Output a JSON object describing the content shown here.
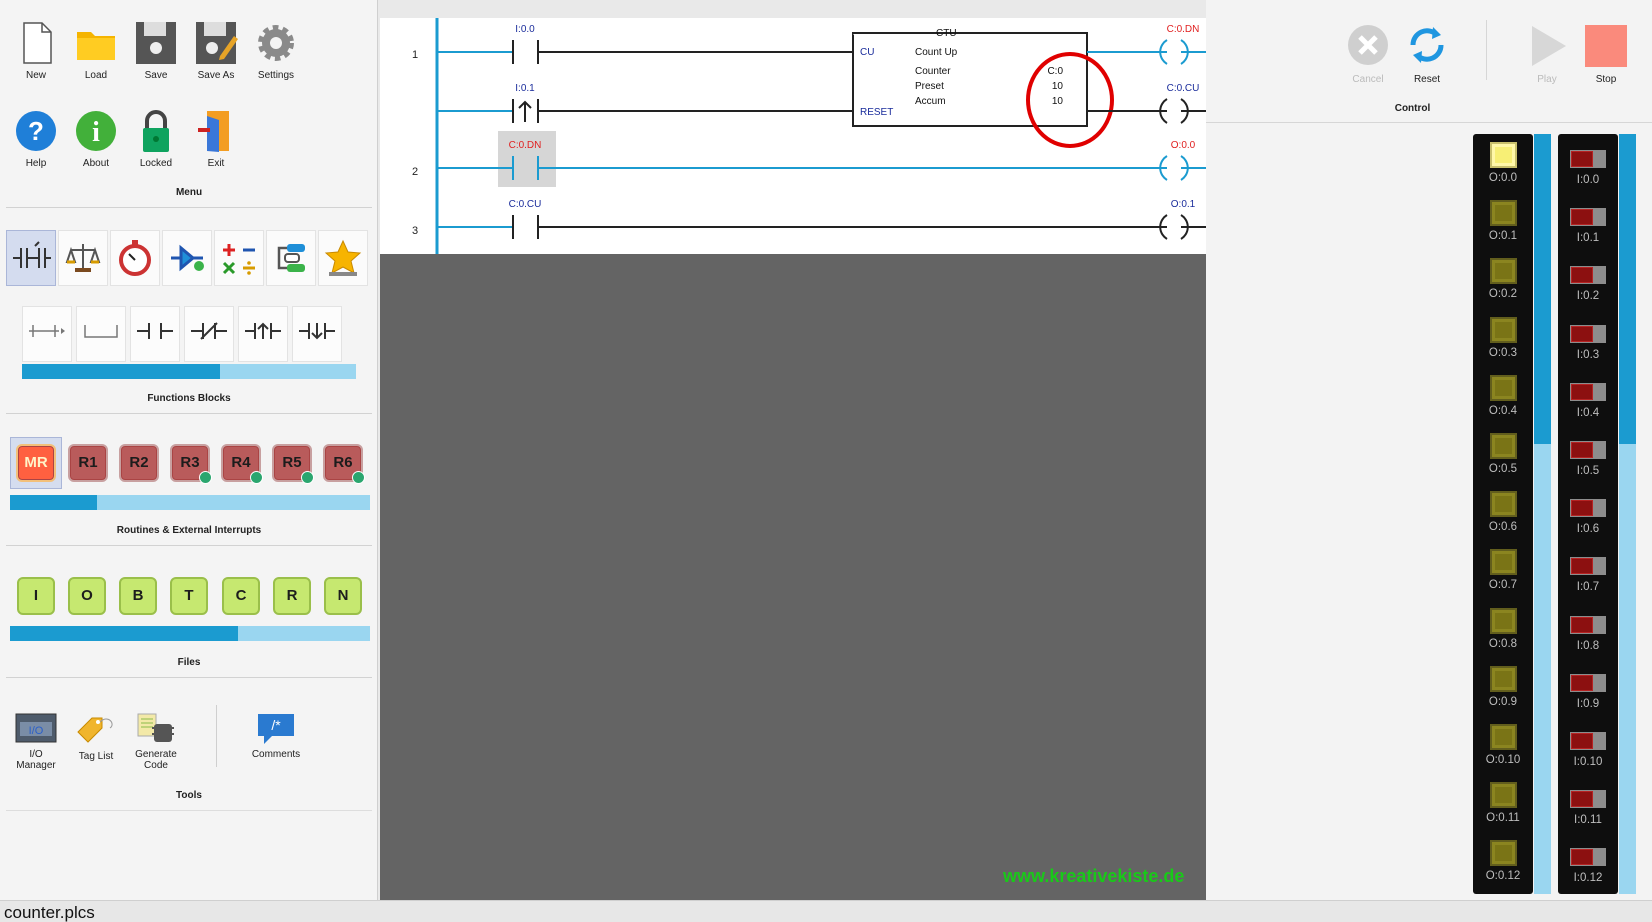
{
  "menu": {
    "buttons": [
      {
        "label": "New",
        "icon": "new-file-icon"
      },
      {
        "label": "Load",
        "icon": "folder-icon"
      },
      {
        "label": "Save",
        "icon": "save-icon"
      },
      {
        "label": "Save As",
        "icon": "save-as-icon"
      },
      {
        "label": "Settings",
        "icon": "gear-icon"
      },
      {
        "label": "Help",
        "icon": "help-icon"
      },
      {
        "label": "About",
        "icon": "info-icon"
      },
      {
        "label": "Locked",
        "icon": "lock-icon"
      },
      {
        "label": "Exit",
        "icon": "exit-icon"
      }
    ],
    "title": "Menu"
  },
  "functions": {
    "title": "Functions Blocks",
    "scroll_fraction": 0.6
  },
  "routines": {
    "title": "Routines & External Interrupts",
    "items": [
      {
        "label": "MR",
        "locked": false
      },
      {
        "label": "R1",
        "locked": false
      },
      {
        "label": "R2",
        "locked": false
      },
      {
        "label": "R3",
        "locked": true
      },
      {
        "label": "R4",
        "locked": true
      },
      {
        "label": "R5",
        "locked": true
      },
      {
        "label": "R6",
        "locked": true
      }
    ],
    "scroll_fraction": 0.24
  },
  "files": {
    "title": "Files",
    "items": [
      "I",
      "O",
      "B",
      "T",
      "C",
      "R",
      "N"
    ],
    "scroll_fraction": 0.63
  },
  "tools": {
    "title": "Tools",
    "items": [
      {
        "label": "I/O\nManager",
        "l1": "I/O",
        "l2": "Manager"
      },
      {
        "label": "Tag List"
      },
      {
        "label": "Generate Code",
        "l1": "Generate",
        "l2": "Code"
      },
      {
        "label": "Comments"
      }
    ],
    "io_icon_text": "I/O"
  },
  "ladder": {
    "rung_numbers": [
      "1",
      "2",
      "3"
    ],
    "contacts": {
      "r1a": "I:0.0",
      "r1b": "I:0.1",
      "r2": "C:0.DN",
      "r3": "C:0.CU"
    },
    "coils": {
      "r1a": "C:0.DN",
      "r1b": "C:0.CU",
      "r2": "O:0.0",
      "r3": "O:0.1"
    },
    "ctu": {
      "title": "CTU",
      "subtitle": "Count Up",
      "cu": "CU",
      "reset": "RESET",
      "counter_label": "Counter",
      "preset_label": "Preset",
      "accum_label": "Accum",
      "counter_value": "C:0",
      "preset_value": "10",
      "accum_value": "10"
    }
  },
  "watermark": "www.kreativekiste.de",
  "control": {
    "title": "Control",
    "buttons": [
      {
        "label": "Cancel",
        "enabled": false
      },
      {
        "label": "Reset",
        "enabled": true
      },
      {
        "label": "Play",
        "enabled": false
      },
      {
        "label": "Stop",
        "enabled": true
      }
    ]
  },
  "outputs": [
    "O:0.0",
    "O:0.1",
    "O:0.2",
    "O:0.3",
    "O:0.4",
    "O:0.5",
    "O:0.6",
    "O:0.7",
    "O:0.8",
    "O:0.9",
    "O:0.10",
    "O:0.11",
    "O:0.12"
  ],
  "inputs": [
    "I:0.0",
    "I:0.1",
    "I:0.2",
    "I:0.3",
    "I:0.4",
    "I:0.5",
    "I:0.6",
    "I:0.7",
    "I:0.8",
    "I:0.9",
    "I:0.10",
    "I:0.11",
    "I:0.12"
  ],
  "output_states": [
    true,
    false,
    false,
    false,
    false,
    false,
    false,
    false,
    false,
    false,
    false,
    false,
    false
  ],
  "status": {
    "filename": "counter.plcs"
  },
  "colors": {
    "accent": "#1b9bd0",
    "wire_active": "#1b9bd0",
    "highlight_red": "#e00000",
    "watermark": "#19c919"
  }
}
